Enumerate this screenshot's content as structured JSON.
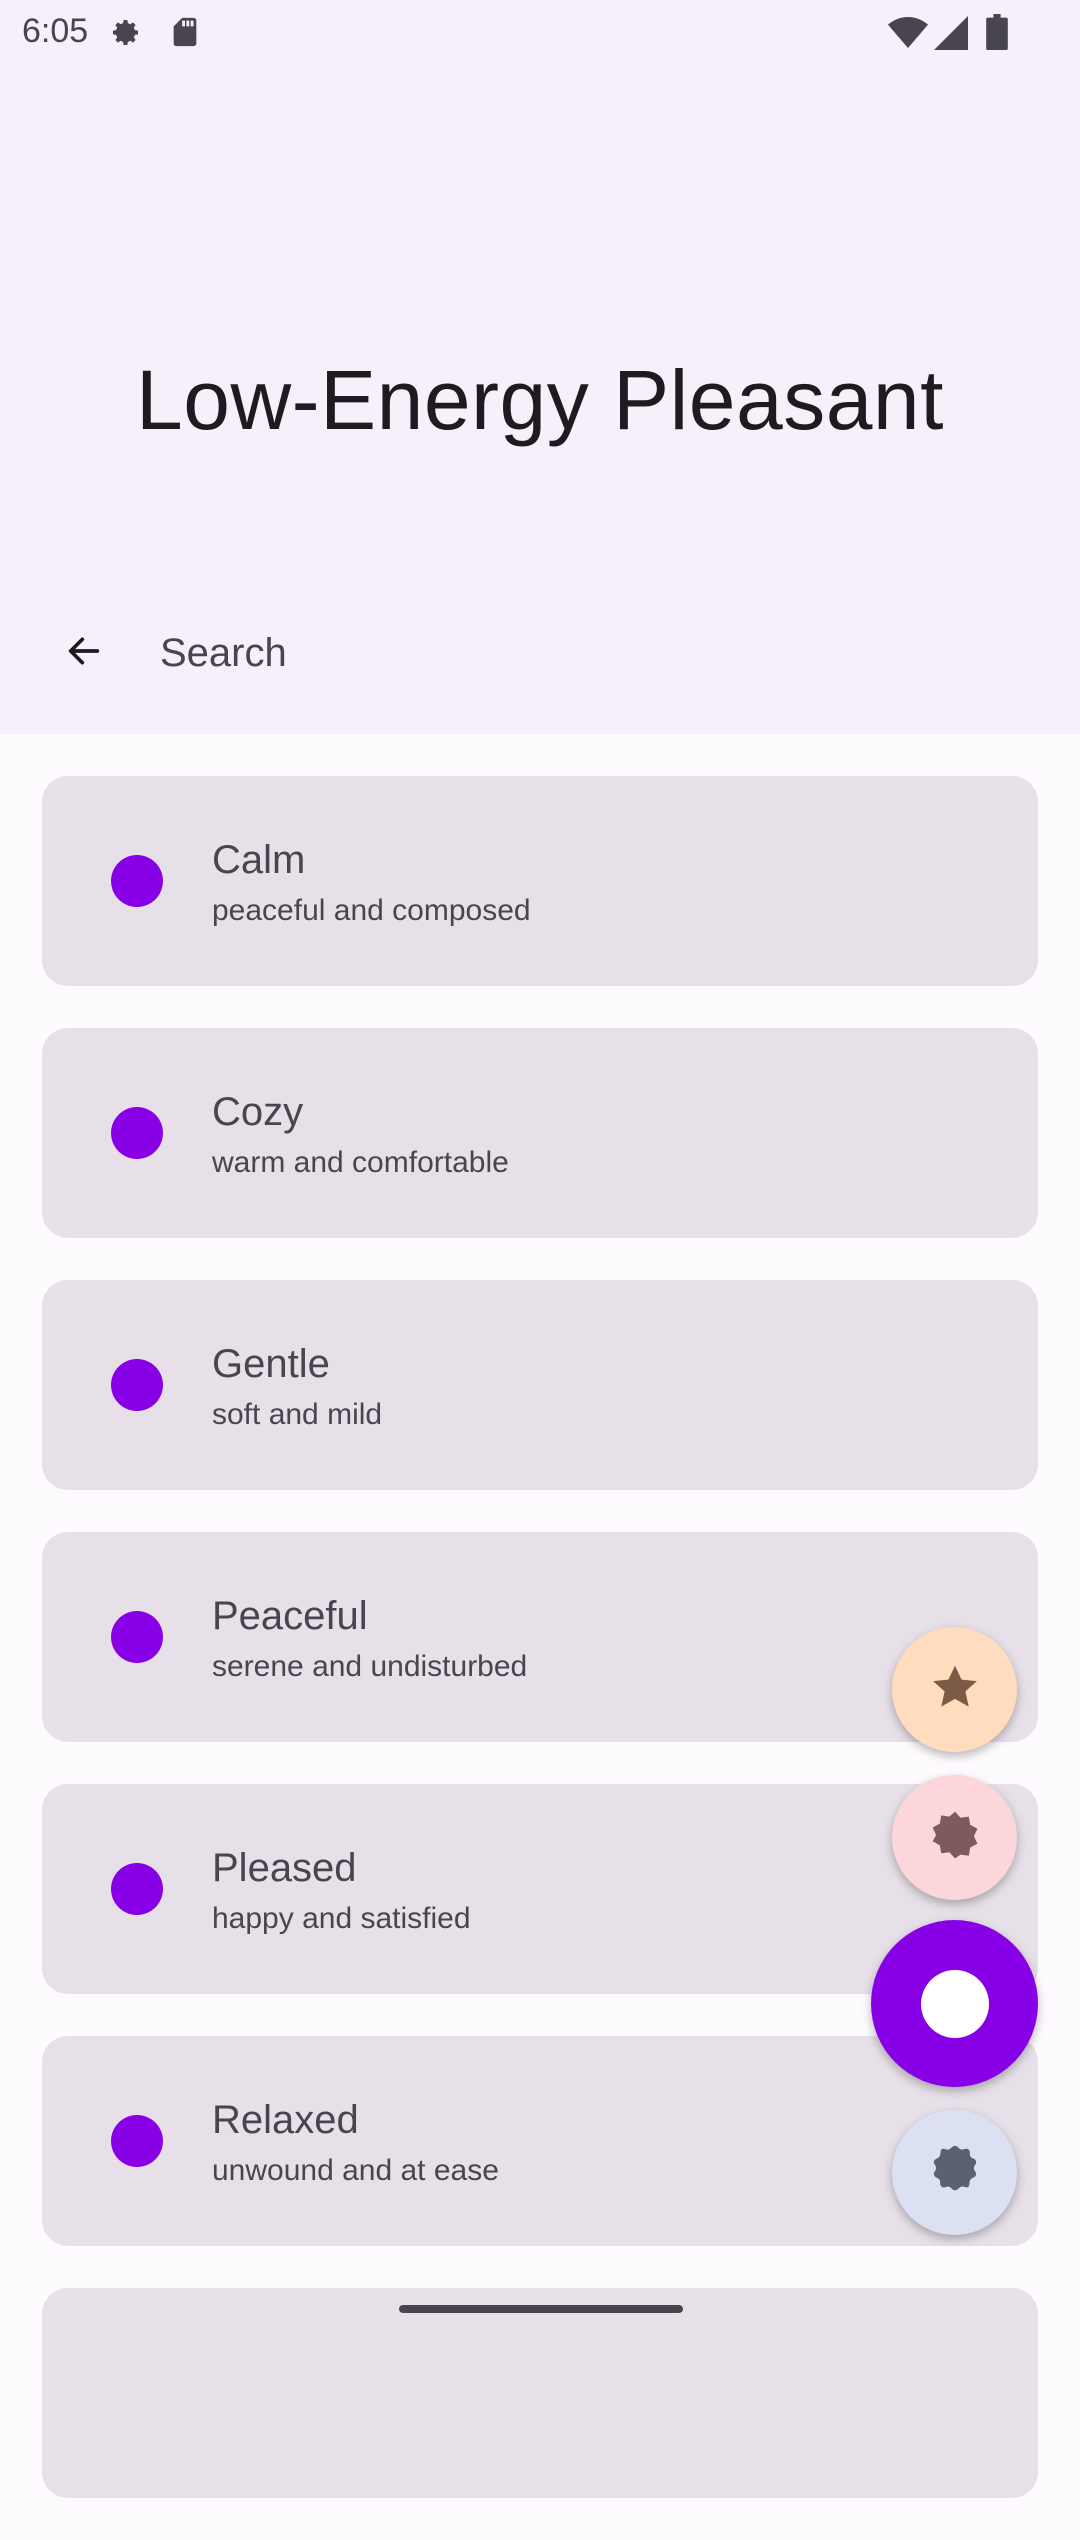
{
  "status_bar": {
    "time": "6:05",
    "left_icons": [
      "settings-icon",
      "sd-card-icon"
    ],
    "right_icons": [
      "wifi-icon",
      "signal-icon",
      "battery-icon"
    ]
  },
  "header": {
    "title": "Low-Energy Pleasant"
  },
  "search": {
    "placeholder": "Search",
    "back_icon": "arrow-back-icon"
  },
  "emotions": [
    {
      "name": "Calm",
      "description": "peaceful and composed"
    },
    {
      "name": "Cozy",
      "description": "warm and comfortable"
    },
    {
      "name": "Gentle",
      "description": "soft and mild"
    },
    {
      "name": "Peaceful",
      "description": "serene and undisturbed"
    },
    {
      "name": "Pleased",
      "description": "happy and satisfied"
    },
    {
      "name": "Relaxed",
      "description": "unwound and at ease"
    },
    {
      "name": "",
      "description": ""
    }
  ],
  "colors": {
    "accent": "#8800e6",
    "header_bg": "#f7f0fb",
    "card_bg": "#e7e0e8",
    "fab_star_bg": "#ffdcbd",
    "fab_badge_bg": "#fbd7db",
    "fab_gear_bg": "#dbe1f3"
  },
  "fabs": [
    "star-icon",
    "badge-icon",
    "circle-icon",
    "gear-icon"
  ]
}
